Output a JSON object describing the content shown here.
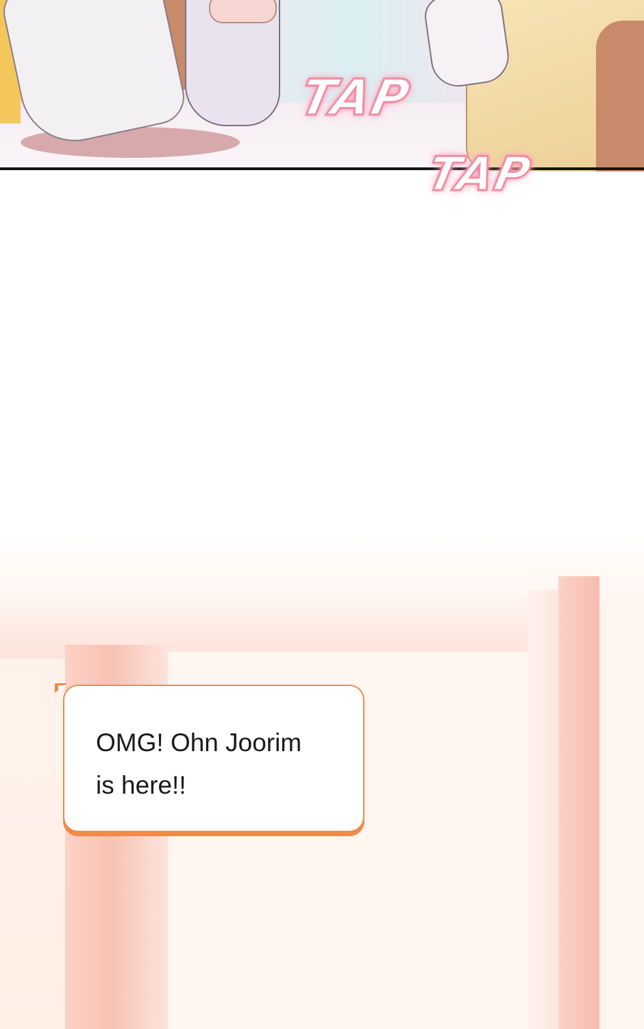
{
  "panel_top": {
    "sfx": [
      "TAP",
      "TAP"
    ]
  },
  "speech_bubble": {
    "lines": [
      "OMG! Ohn Joorim",
      "is here!!"
    ]
  },
  "colors": {
    "bubble_border": "#f28a4a",
    "sfx_outline": "#f08ea3",
    "panel_border": "#141414"
  }
}
